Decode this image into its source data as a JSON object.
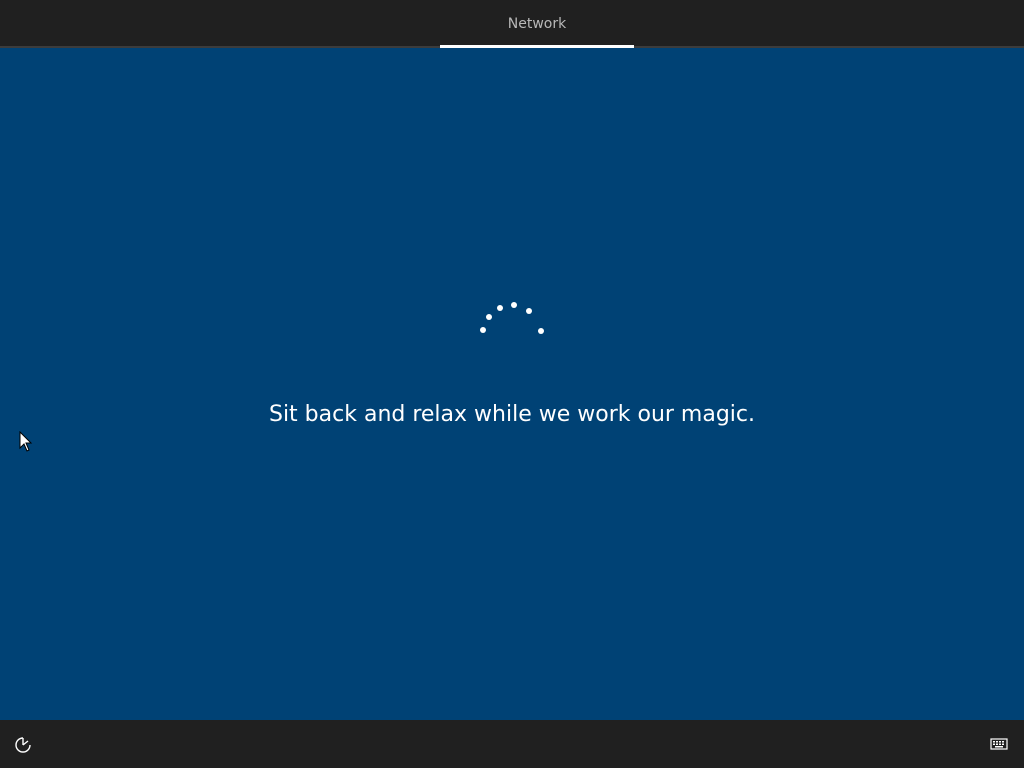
{
  "header": {
    "tabs": [
      {
        "label": "Network",
        "active": true
      }
    ]
  },
  "main": {
    "message": "Sit back and relax while we work our magic.",
    "spinner_icon": "loading-dots-icon"
  },
  "footer": {
    "left_icon": "ease-of-access-icon",
    "right_icon": "keyboard-icon"
  },
  "colors": {
    "background": "#004275",
    "bar": "#202020",
    "text": "#ffffff",
    "tab_text": "#b8b8b8"
  }
}
